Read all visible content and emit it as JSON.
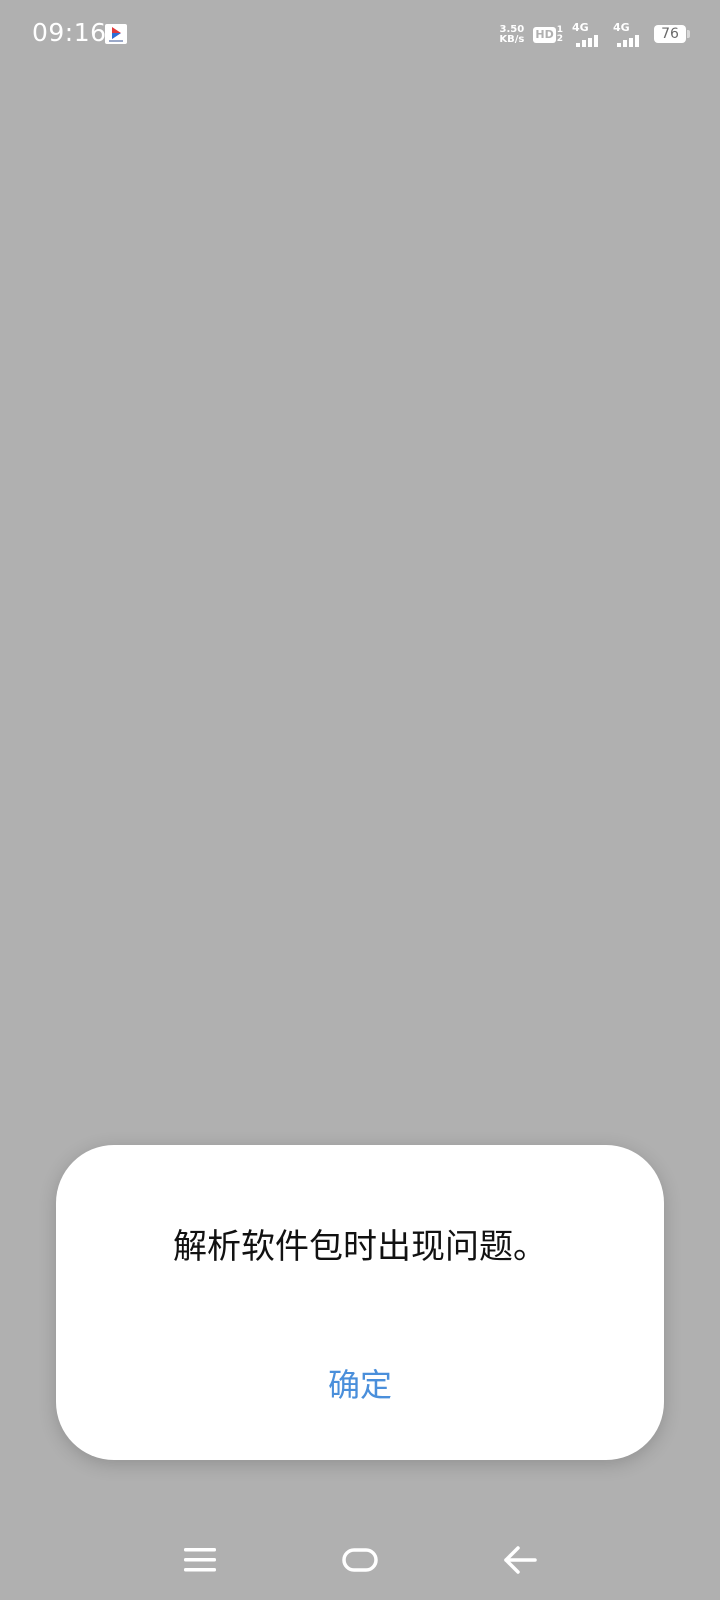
{
  "status_bar": {
    "time": "09:16",
    "net_speed_value": "3.50",
    "net_speed_unit": "KB/s",
    "hd_label": "HD",
    "hd_sim_top": "1",
    "hd_sim_bottom": "2",
    "sim1_network": "4G",
    "sim2_network": "4G",
    "battery_level": "76"
  },
  "dialog": {
    "message": "解析软件包时出现问题。",
    "confirm_label": "确定",
    "accent_color": "#4a8fdb"
  },
  "nav_bar": {
    "menu_icon": "menu-icon",
    "home_icon": "home-icon",
    "back_icon": "back-arrow-icon"
  }
}
